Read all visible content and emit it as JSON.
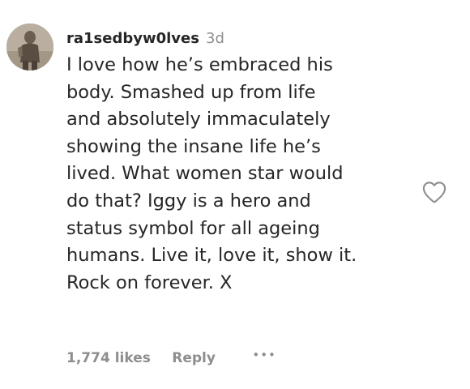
{
  "comment": {
    "username": "ra1sedbyw0lves",
    "timestamp": "3d",
    "text_lines": [
      "I love how he’s embraced his",
      "body. Smashed up from life",
      "and absolutely immaculately",
      "showing the insane life he’s",
      "lived. What women star would",
      "do that? Iggy is a hero and",
      "status symbol for all ageing",
      "humans. Live it, love it, show it.",
      "Rock on forever. X"
    ],
    "likes_label": "1,774 likes",
    "reply_label": "Reply",
    "more_label": "•••"
  },
  "icons": {
    "avatar": "profile-photo",
    "like": "heart-outline-icon",
    "more": "ellipsis-icon"
  },
  "colors": {
    "text": "#262626",
    "secondary_text": "#8e8e8e",
    "background": "#ffffff"
  }
}
